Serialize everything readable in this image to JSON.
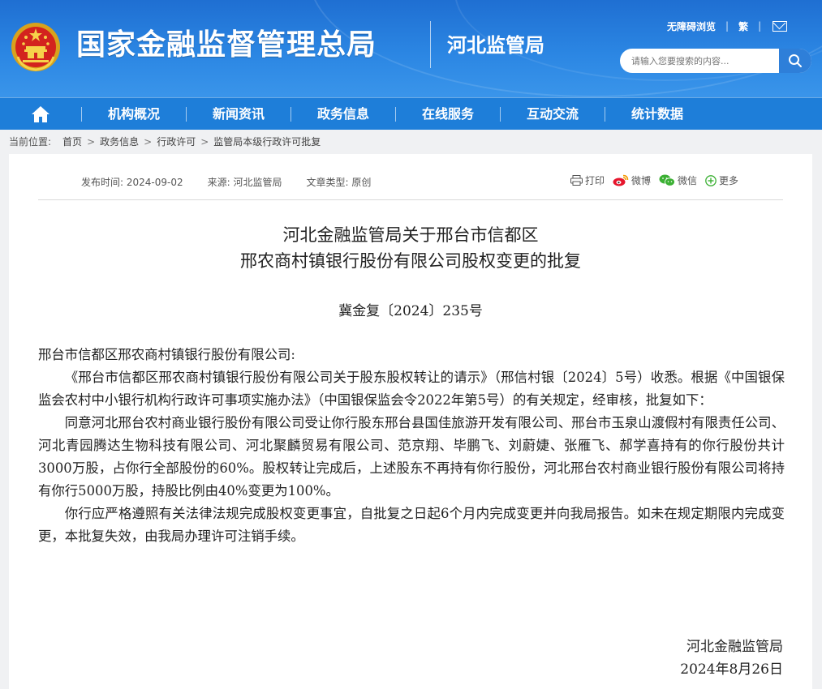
{
  "header": {
    "site_name": "国家金融监督管理总局",
    "branch_name": "河北监管局",
    "accessibility_link": "无障碍浏览",
    "traditional_link": "繁",
    "search": {
      "placeholder": "请输入您要搜索的内容..."
    },
    "brand_color": "#2b86e3"
  },
  "nav": {
    "items": [
      "机构概况",
      "新闻资讯",
      "政务信息",
      "在线服务",
      "互动交流",
      "统计数据"
    ]
  },
  "breadcrumb": {
    "lead": "当前位置:",
    "items": [
      "首页",
      "政务信息",
      "行政许可",
      "监管局本级行政许可批复"
    ]
  },
  "article": {
    "publish_time": "发布时间:  2024-09-02",
    "source": "来源:  河北监管局",
    "doc_type": "文章类型:  原创",
    "share": {
      "print": "打印",
      "weibo": "微博",
      "wechat": "微信",
      "more": "更多"
    },
    "title_line1": "河北金融监管局关于邢台市信都区",
    "title_line2": "邢农商村镇银行股份有限公司股权变更的批复",
    "doc_number": "冀金复〔2024〕235号",
    "salutation": "邢台市信都区邢农商村镇银行股份有限公司:",
    "paragraphs": [
      "《邢台市信都区邢农商村镇银行股份有限公司关于股东股权转让的请示》（邢信村银〔2024〕5号）收悉。根据《中国银保监会农村中小银行机构行政许可事项实施办法》（中国银保监会令2022年第5号）的有关规定，经审核，批复如下：",
      "同意河北邢台农村商业银行股份有限公司受让你行股东邢台县国佳旅游开发有限公司、邢台市玉泉山渡假村有限责任公司、河北青园腾达生物科技有限公司、河北聚麟贸易有限公司、范京翔、毕鹏飞、刘蔚婕、张雁飞、郝学喜持有的你行股份共计3000万股，占你行全部股份的60%。股权转让完成后，上述股东不再持有你行股份，河北邢台农村商业银行股份有限公司将持有你行5000万股，持股比例由40%变更为100%。",
      "你行应严格遵照有关法律法规完成股权变更事宜，自批复之日起6个月内完成变更并向我局报告。如未在规定期限内完成变更，本批复失效，由我局办理许可注销手续。"
    ],
    "signature_org": "河北金融监管局",
    "signature_date": "2024年8月26日"
  }
}
